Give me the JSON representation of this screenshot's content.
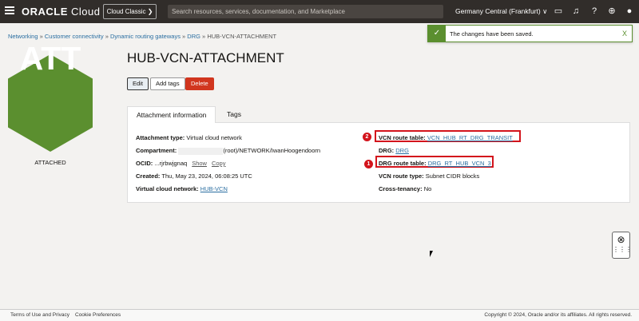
{
  "header": {
    "brand_bold": "ORACLE",
    "brand_light": "Cloud",
    "classic_button": "Cloud Classic ❯",
    "search_placeholder": "Search resources, services, documentation, and Marketplace",
    "region": "Germany Central (Frankfurt) ∨"
  },
  "breadcrumb": [
    "Networking",
    "Customer connectivity",
    "Dynamic routing gateways",
    "DRG",
    "HUB-VCN-ATTACHMENT"
  ],
  "toast": {
    "message": "The changes have been saved.",
    "close": "X"
  },
  "resource": {
    "icon_text": "ATT",
    "status": "ATTACHED",
    "title": "HUB-VCN-ATTACHMENT",
    "color": "#5b8f2f"
  },
  "actions": {
    "edit": "Edit",
    "add_tags": "Add tags",
    "delete": "Delete"
  },
  "tabs": [
    "Attachment information",
    "Tags"
  ],
  "details_left": [
    {
      "label": "Attachment type:",
      "value": "Virtual cloud network"
    },
    {
      "label": "Compartment:",
      "value": "(root)/NETWORK/IwanHoogendoorn"
    },
    {
      "label": "OCID:",
      "value": "...rjrbwjgnaq",
      "show": "Show",
      "copy": "Copy"
    },
    {
      "label": "Created:",
      "value": "Thu, May 23, 2024, 06:08:25 UTC"
    },
    {
      "label": "Virtual cloud network:",
      "link": "HUB-VCN"
    }
  ],
  "details_right": [
    {
      "label": "VCN route table:",
      "link": "VCN_HUB_RT_DRG_TRANSIT",
      "marker": "2"
    },
    {
      "label": "DRG:",
      "link": "DRG"
    },
    {
      "label": "DRG route table:",
      "link": "DRG_RT_HUB_VCN_3",
      "marker": "1"
    },
    {
      "label": "VCN route type:",
      "value": "Subnet CIDR blocks"
    },
    {
      "label": "Cross-tenancy:",
      "value": "No"
    }
  ],
  "footer": {
    "terms": "Terms of Use and Privacy",
    "cookies": "Cookie Preferences",
    "copyright": "Copyright © 2024, Oracle and/or its affiliates. All rights reserved."
  }
}
